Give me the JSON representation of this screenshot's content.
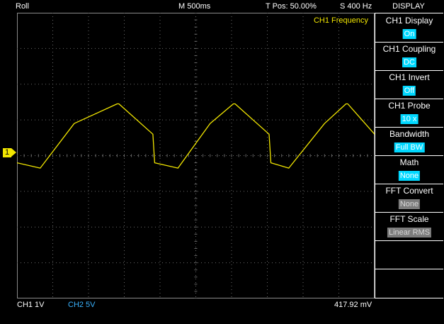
{
  "status": {
    "mode": "Roll",
    "timebase": "M 500ms",
    "trigger_pos": "T Pos: 50.00%",
    "sample_rate": "S 400 Hz"
  },
  "measurement_label": "CH1 Frequency",
  "channel_marker": "1",
  "menu": {
    "title": "DISPLAY",
    "items": [
      {
        "label": "CH1 Display",
        "value": "On",
        "state": "on"
      },
      {
        "label": "CH1 Coupling",
        "value": "DC",
        "state": "on"
      },
      {
        "label": "CH1 Invert",
        "value": "Off",
        "state": "on"
      },
      {
        "label": "CH1 Probe",
        "value": "10 x",
        "state": "on"
      },
      {
        "label": "Bandwidth",
        "value": "Full BW",
        "state": "on"
      },
      {
        "label": "Math",
        "value": "None",
        "state": "on"
      },
      {
        "label": "FFT Convert",
        "value": "None",
        "state": "off"
      },
      {
        "label": "FFT Scale",
        "value": "Linear RMS",
        "state": "off"
      },
      {
        "label": "",
        "value": "",
        "state": "none"
      },
      {
        "label": "",
        "value": "",
        "state": "none"
      }
    ]
  },
  "bottom": {
    "ch1_scale": "CH1  1V",
    "ch2_scale": "CH2  5V",
    "readout": "417.92 mV"
  },
  "colors": {
    "ch1": "#f2e600",
    "ch2": "#3ab4ff",
    "grid": "#6a6a6a",
    "highlight": "#00d8ff"
  },
  "chart_data": {
    "type": "line",
    "x_divisions": 10,
    "y_divisions": 8,
    "grid": true,
    "series": [
      {
        "x": [
          0,
          0.65,
          1.6,
          2.8,
          2.85,
          3.8,
          3.85,
          4.5,
          5.4,
          6.05,
          6.1,
          7.05,
          7.1,
          7.6,
          8.6,
          9.2,
          9.25,
          10
        ],
        "y": [
          -0.2,
          -0.35,
          0.9,
          1.45,
          1.45,
          0.6,
          -0.2,
          -0.35,
          0.9,
          1.45,
          1.45,
          0.6,
          -0.2,
          -0.35,
          0.9,
          1.45,
          1.45,
          0.6
        ]
      }
    ]
  }
}
